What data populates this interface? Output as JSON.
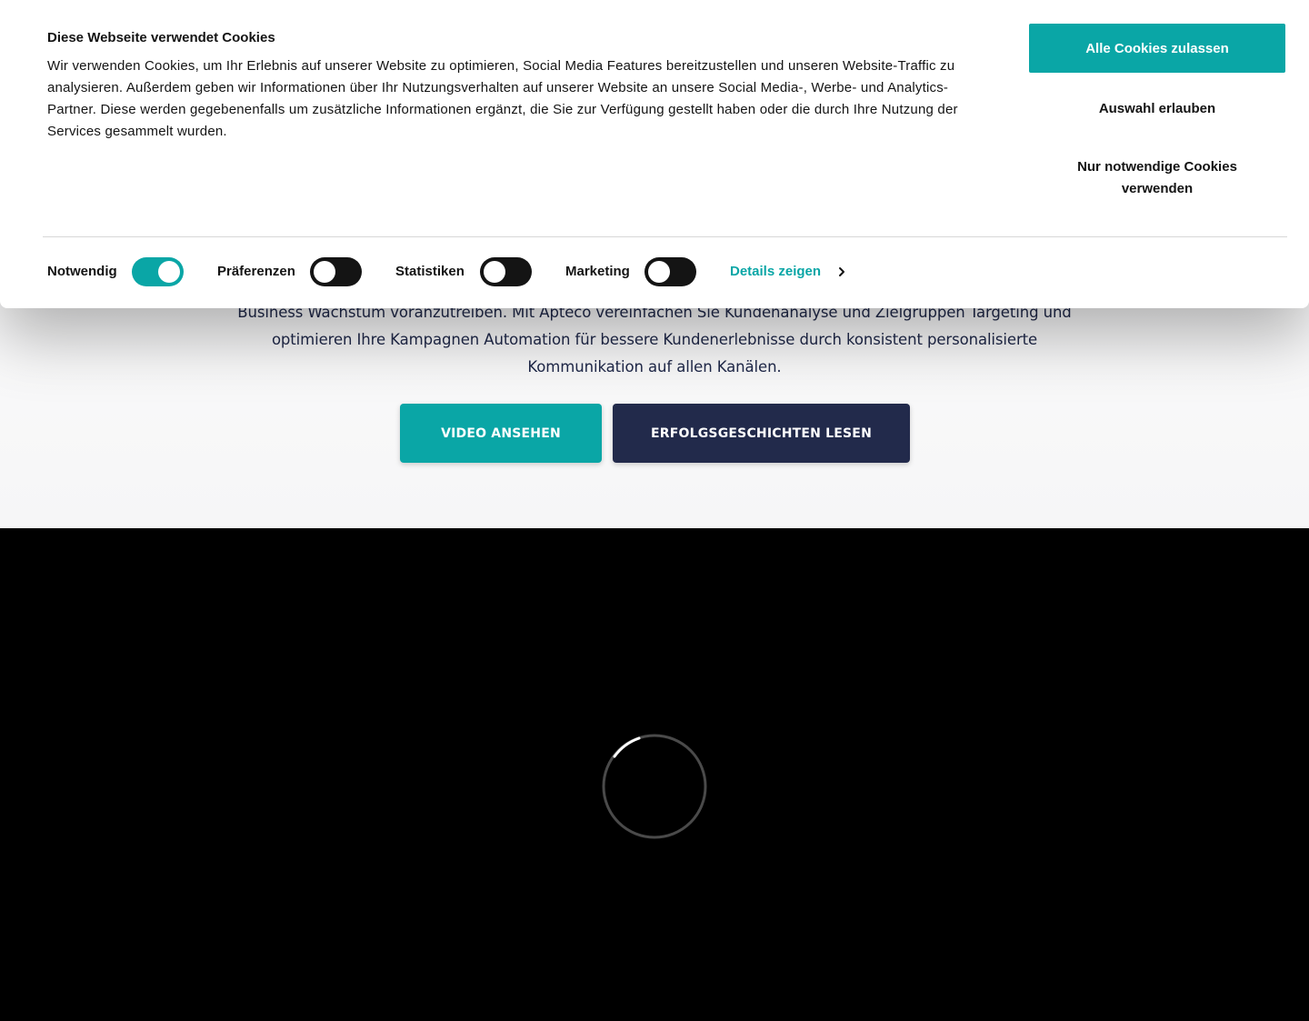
{
  "cookie_banner": {
    "title": "Diese Webseite verwendet Cookies",
    "text": "Wir verwenden Cookies, um Ihr Erlebnis auf unserer Website zu optimieren, Social Media Features bereitzustellen und unseren Website-Traffic zu analysieren. Außerdem geben wir Informationen über Ihr Nutzungsverhalten auf unserer Website an unsere Social Media-, Werbe- und Analytics-Partner. Diese werden gegebenenfalls um zusätzliche Informationen ergänzt, die Sie zur Verfügung gestellt haben oder die durch Ihre Nutzung der Services gesammelt wurden.",
    "buttons": {
      "allow_all": "Alle Cookies zulassen",
      "allow_selection": "Auswahl erlauben",
      "necessary_only_line1": "Nur notwendige Cookies",
      "necessary_only_line2": "verwenden"
    },
    "toggles": [
      {
        "label": "Notwendig",
        "checked": true
      },
      {
        "label": "Präferenzen",
        "checked": false
      },
      {
        "label": "Statistiken",
        "checked": false
      },
      {
        "label": "Marketing",
        "checked": false
      }
    ],
    "details_link": "Details zeigen"
  },
  "hero": {
    "text_line1": "Business Wachstum voranzutreiben. Mit Apteco vereinfachen Sie Kundenanalyse und Zielgruppen Targeting und",
    "text_line2": "optimieren Ihre Kampagnen Automation für bessere Kundenerlebnisse durch konsistent personalisierte",
    "text_line3": "Kommunikation auf allen Kanälen.",
    "video_button": "VIDEO ANSEHEN",
    "stories_button": "ERFOLGSGESCHICHTEN LESEN"
  },
  "colors": {
    "accent": "#0aa6a6",
    "navy": "#222a4b",
    "text_dark": "#141414"
  },
  "icons": {
    "details": "chevron-right-icon",
    "video_loading": "loading-spinner-icon"
  }
}
